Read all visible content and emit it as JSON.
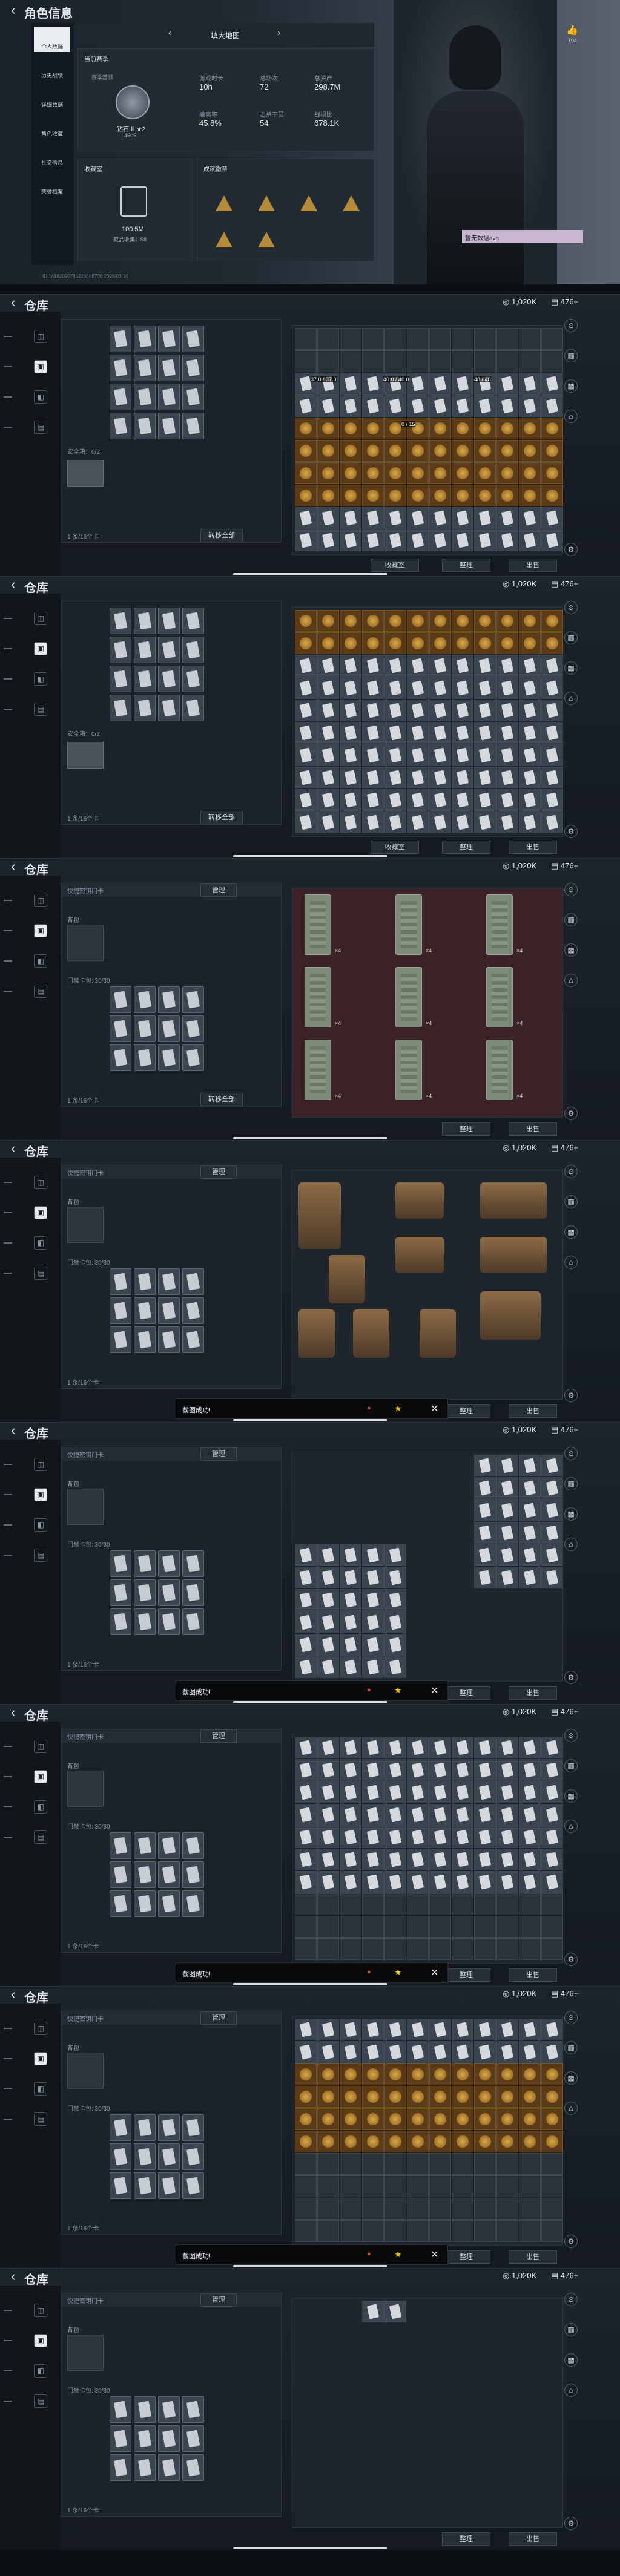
{
  "profile": {
    "title": "角色信息",
    "nav": [
      "个人数据",
      "历史战绩",
      "详细数据",
      "角色收藏",
      "社交信息",
      "荣誉档案"
    ],
    "map": "填大地图",
    "season_label": "当前赛季",
    "season_sub": "赛季首领",
    "rank": "钻石 Ⅲ ★2",
    "rank_pts": "4505",
    "stats": [
      {
        "k": "游戏时长",
        "v": "10h"
      },
      {
        "k": "总场次",
        "v": "72"
      },
      {
        "k": "总资产",
        "v": "298.7M"
      },
      {
        "k": "撤离率",
        "v": "45.8%"
      },
      {
        "k": "击杀干员",
        "v": "54"
      },
      {
        "k": "战损比",
        "v": "678.1K"
      }
    ],
    "vault_title": "收藏室",
    "vault_value": "100.5M",
    "vault_sub": "藏品收集：58",
    "collect_title": "成就徽章",
    "likes": "104",
    "user_tag": "暂无数据ava",
    "bottom_text": "ID:14182090745214466706 2026/03/14"
  },
  "header": {
    "title": "仓库",
    "currency": "1,020K",
    "coupons": "476",
    "plus": "+"
  },
  "panels": [
    {
      "safe": "安全箱：0/2",
      "pocket": "1 条/16个卡",
      "transfer": "转移全部",
      "collect": "收藏室",
      "tidy": "整理",
      "sell": "出售",
      "stat1": "37.0 / 37.0",
      "stat2": "40.0 / 40.0",
      "stat3": "48 / 48",
      "stat4": "0 / 15"
    },
    {
      "safe": "安全箱：0/2",
      "pocket": "1 条/16个卡",
      "transfer": "转移全部",
      "collect": "收藏室",
      "tidy": "整理",
      "sell": "出售"
    },
    {
      "quick": "快捷密钥门卡",
      "manage": "管理",
      "backpack": "背包",
      "keys": "门禁卡包: 30/30",
      "pocket": "1 条/16个卡",
      "transfer": "转移全部",
      "tidy": "整理",
      "sell": "出售",
      "items": [
        "×4",
        "×4",
        "×4",
        "×4",
        "×4",
        "×4",
        "×4",
        "×4",
        "×4"
      ]
    },
    {
      "quick": "快捷密钥门卡",
      "manage": "管理",
      "backpack": "背包",
      "keys": "门禁卡包: 30/30",
      "pocket": "1 条/16个卡",
      "toast": "截图成功!",
      "tidy": "整理",
      "sell": "出售"
    },
    {
      "quick": "快捷密钥门卡",
      "manage": "管理",
      "backpack": "背包",
      "keys": "门禁卡包: 30/30",
      "pocket": "1 条/16个卡",
      "toast": "截图成功!",
      "tidy": "整理",
      "sell": "出售"
    },
    {
      "quick": "快捷密钥门卡",
      "manage": "管理",
      "backpack": "背包",
      "keys": "门禁卡包: 30/30",
      "pocket": "1 条/16个卡",
      "toast": "截图成功!",
      "tidy": "整理",
      "sell": "出售"
    },
    {
      "quick": "快捷密钥门卡",
      "manage": "管理",
      "backpack": "背包",
      "keys": "门禁卡包: 30/30",
      "pocket": "1 条/16个卡",
      "toast": "截图成功!",
      "tidy": "整理",
      "sell": "出售"
    },
    {
      "quick": "快捷密钥门卡",
      "manage": "管理",
      "backpack": "背包",
      "keys": "门禁卡包: 30/30",
      "pocket": "1 条/16个卡",
      "tidy": "整理",
      "sell": "出售"
    }
  ]
}
